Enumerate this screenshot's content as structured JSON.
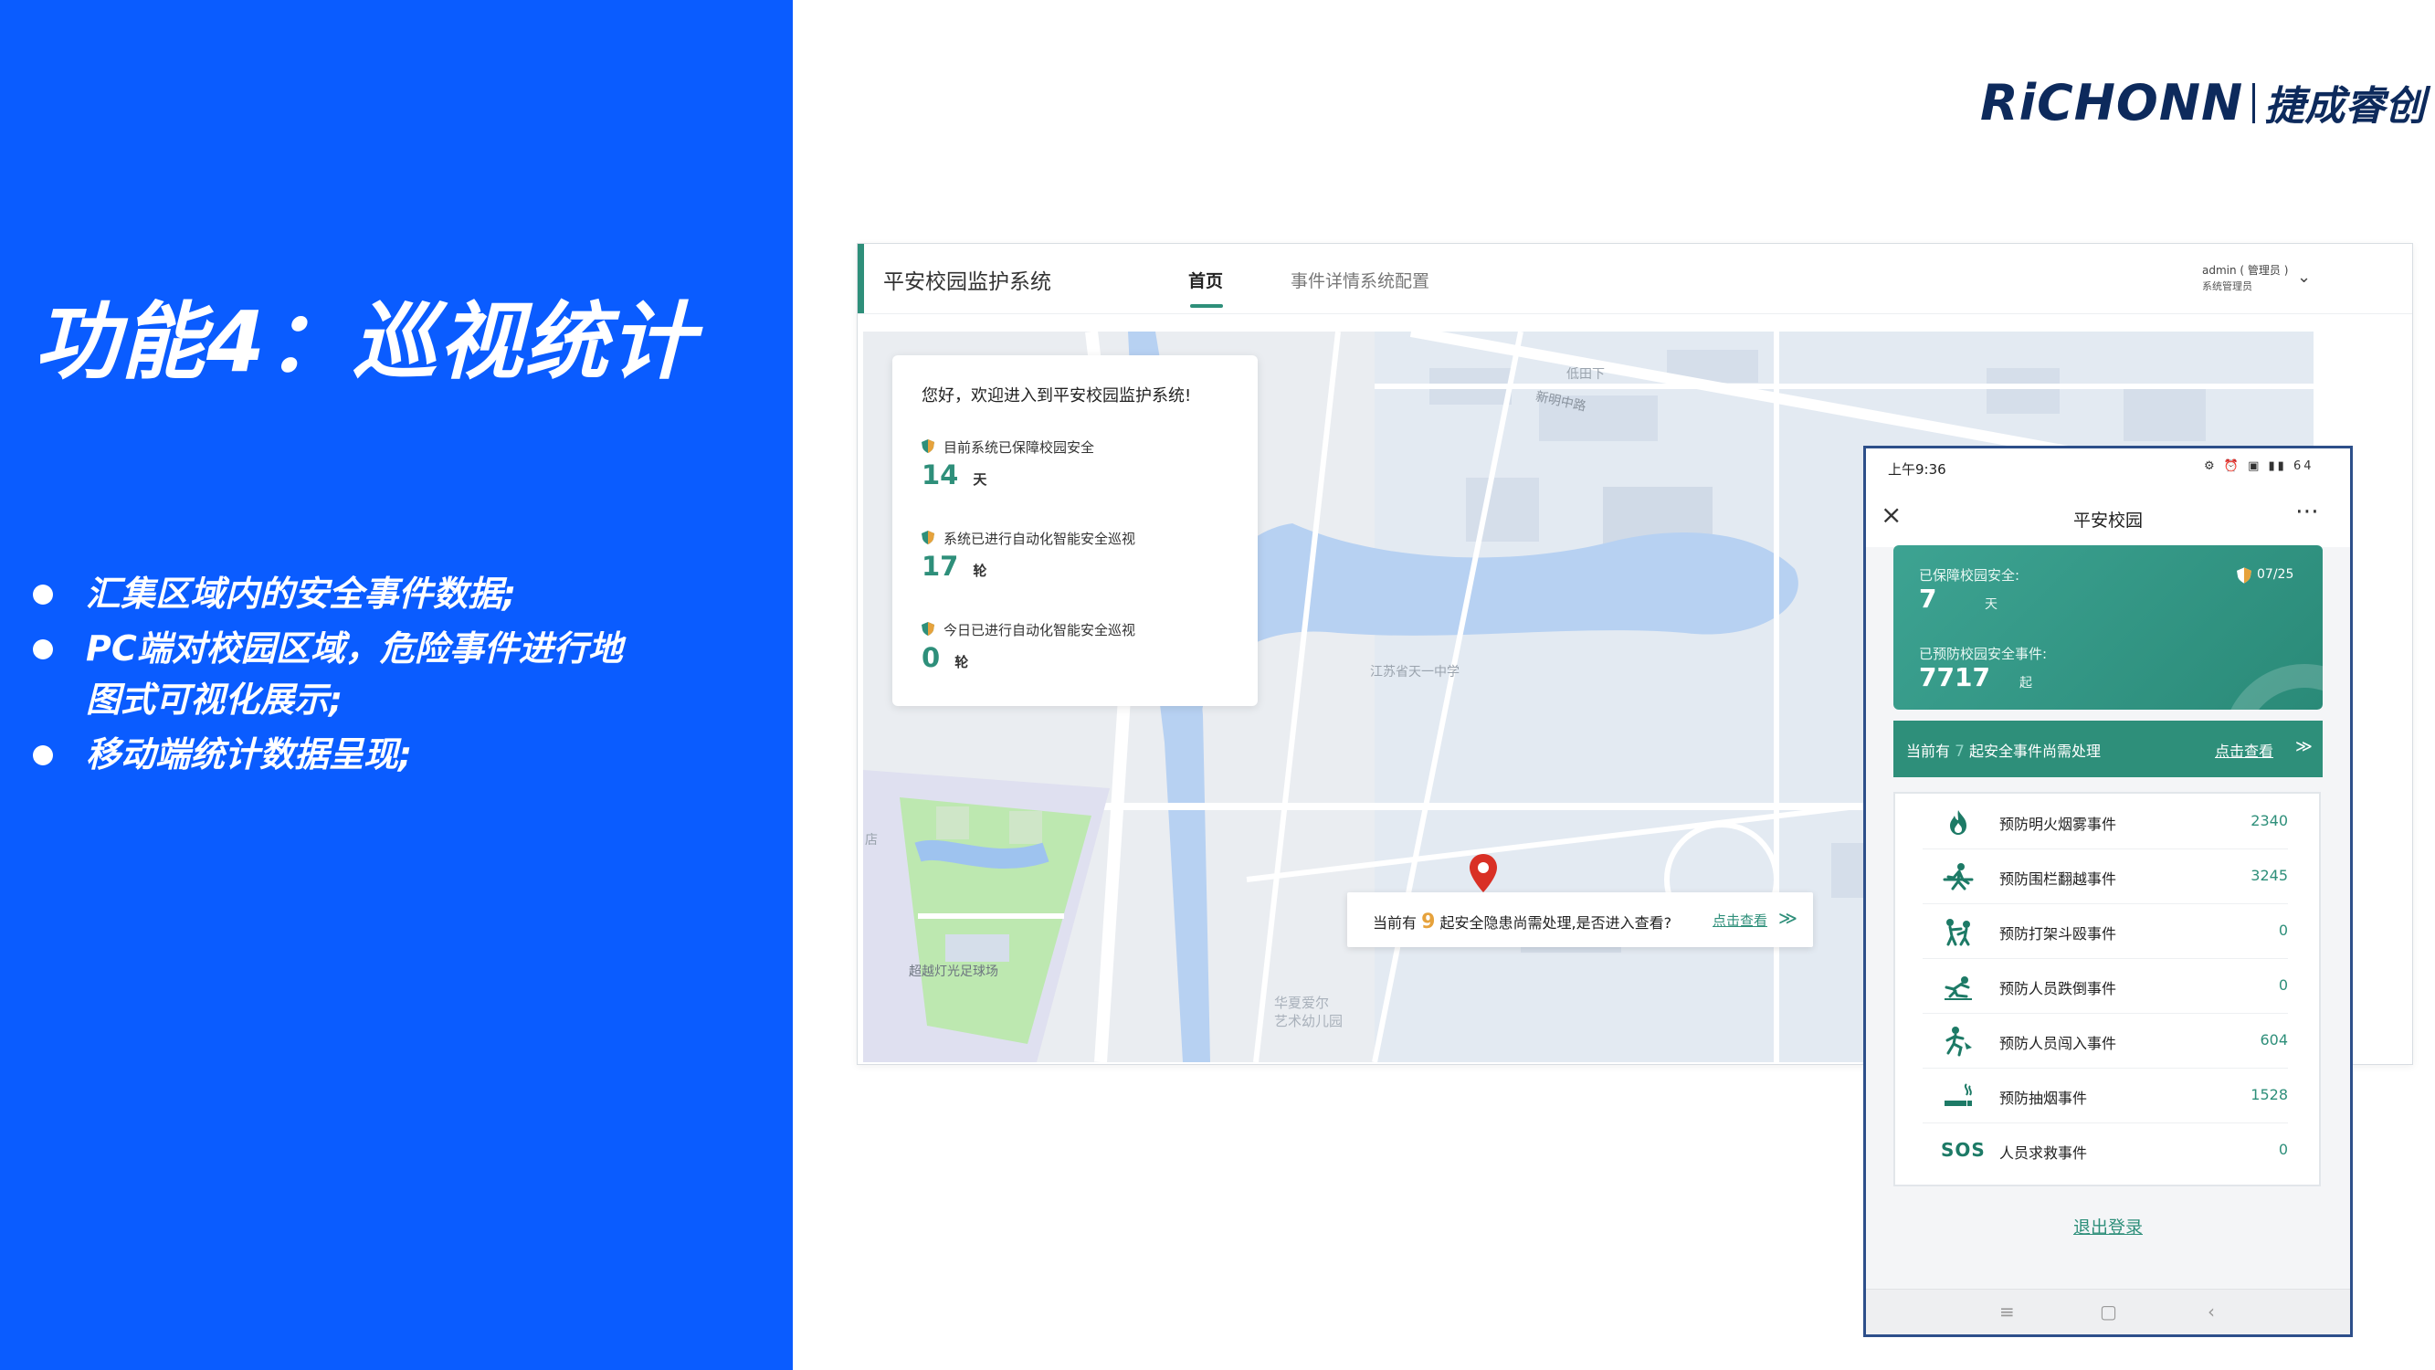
{
  "slide": {
    "title": "功能4：巡视统计",
    "bullets": [
      "汇集区域内的安全事件数据;",
      "PC端对校园区域，危险事件进行地",
      "图式可视化展示;",
      "移动端统计数据呈现;"
    ]
  },
  "logo": {
    "brand": "RiCHONN",
    "cn": "捷成睿创"
  },
  "pc": {
    "title": "平安校园监护系统",
    "nav": {
      "home": "首页",
      "events": "事件详情",
      "config": "系统配置"
    },
    "user": {
      "name": "admin ( 管理员 )",
      "role": "系统管理员"
    },
    "map_labels": {
      "district": "低田下",
      "road": "新明中路",
      "school": "江苏省天一中学",
      "field": "超越灯光足球场",
      "kindergarten_1": "华夏爱尔",
      "kindergarten_2": "艺术幼儿园",
      "edge": "店"
    },
    "welcome": {
      "greeting": "您好，欢迎进入到平安校园监护系统!",
      "stats": [
        {
          "label": "目前系统已保障校园安全",
          "value": "14",
          "unit": "天"
        },
        {
          "label": "系统已进行自动化智能安全巡视",
          "value": "17",
          "unit": "轮"
        },
        {
          "label": "今日已进行自动化智能安全巡视",
          "value": "0",
          "unit": "轮"
        }
      ]
    },
    "alert": {
      "prefix": "当前有",
      "count": "9",
      "suffix": "起安全隐患尚需处理,是否进入查看?",
      "link": "点击查看",
      "chevrons": "≫"
    }
  },
  "phone": {
    "time": "上午9:36",
    "status_icons": "⚙ ⏰ ▣ ▮▮ 64",
    "title": "平安校园",
    "summary": {
      "safe_label": "已保障校园安全:",
      "safe_value": "7",
      "safe_unit": "天",
      "date": "07/25",
      "prevented_label": "已预防校园安全事件:",
      "prevented_value": "7717",
      "prevented_unit": "起"
    },
    "pending": {
      "prefix": "当前有",
      "count": "7",
      "suffix": "起安全事件尚需处理",
      "link": "点击查看",
      "chevrons": "≫"
    },
    "events": [
      {
        "label": "预防明火烟雾事件",
        "count": "2340",
        "icon": "fire-icon"
      },
      {
        "label": "预防围栏翻越事件",
        "count": "3245",
        "icon": "climb-icon"
      },
      {
        "label": "预防打架斗殴事件",
        "count": "0",
        "icon": "fight-icon"
      },
      {
        "label": "预防人员跌倒事件",
        "count": "0",
        "icon": "fall-icon"
      },
      {
        "label": "预防人员闯入事件",
        "count": "604",
        "icon": "intrusion-icon"
      },
      {
        "label": "预防抽烟事件",
        "count": "1528",
        "icon": "smoking-icon"
      },
      {
        "label": "人员求救事件",
        "count": "0",
        "icon": "sos-icon",
        "sos_text": "SOS"
      }
    ],
    "logout": "退出登录",
    "navkeys": {
      "menu": "≡",
      "home": "▢",
      "back": "‹"
    }
  },
  "colors": {
    "primary_blue": "#0a5cff",
    "teal": "#2e8f7a",
    "warning": "#e6a23c",
    "pin_red": "#d93025"
  }
}
